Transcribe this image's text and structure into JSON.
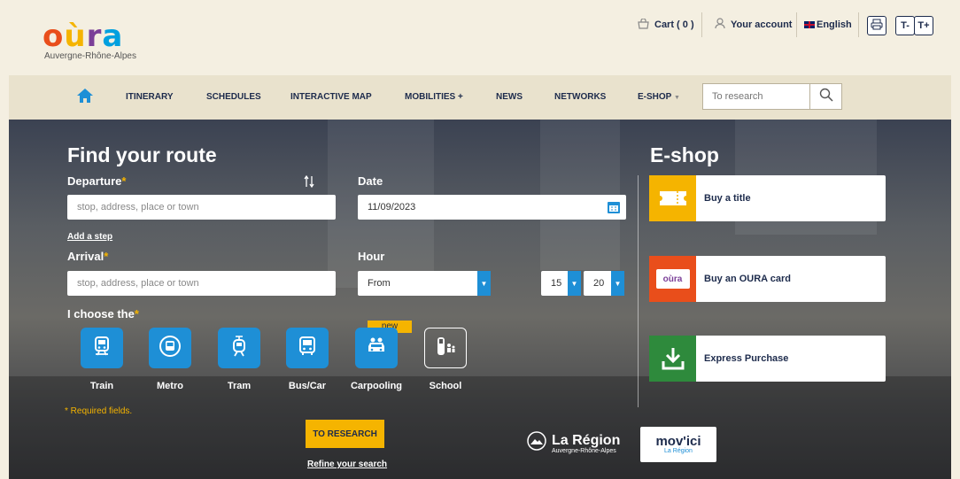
{
  "brand": {
    "logo_letters": [
      "o",
      "ù",
      "r",
      "a"
    ],
    "logo_colors": [
      "#e94e1b",
      "#f5b400",
      "#7b3f98",
      "#00a0df"
    ],
    "tagline": "Auvergne-Rhône-Alpes"
  },
  "topbar": {
    "cart": "Cart ( 0 )",
    "account": "Your account",
    "language": "English",
    "text_smaller": "T-",
    "text_larger": "T+"
  },
  "nav": {
    "items": [
      "ITINERARY",
      "SCHEDULES",
      "INTERACTIVE MAP",
      "MOBILITIES +",
      "NEWS",
      "NETWORKS",
      "E-SHOP"
    ],
    "search_placeholder": "To research"
  },
  "route": {
    "title": "Find your route",
    "departure_label": "Departure",
    "departure_placeholder": "stop, address, place or town",
    "add_step": "Add a step",
    "arrival_label": "Arrival",
    "arrival_placeholder": "stop, address, place or town",
    "date_label": "Date",
    "date_value": "11/09/2023",
    "hour_label": "Hour",
    "hour_mode": "From",
    "hour_h": "15",
    "hour_m": "20",
    "choose_label": "I choose the",
    "required_mark": "*",
    "modes": [
      "Train",
      "Metro",
      "Tram",
      "Bus/Car",
      "Carpooling",
      "School"
    ],
    "new_badge": "new",
    "required_note": "* Required fields.",
    "search_button": "TO RESEARCH",
    "refine_link": "Refine your search"
  },
  "eshop": {
    "title": "E-shop",
    "cards": [
      "Buy a title",
      "Buy an OURA card",
      "Express Purchase"
    ],
    "card_colors": [
      "#f5b400",
      "#e94e1b",
      "#2e8a3c"
    ],
    "oura_mini": "oùra"
  },
  "partners": {
    "region_name": "La Région",
    "region_sub": "Auvergne-Rhône-Alpes",
    "movici": "mov'ici",
    "movici_sub": "La Région"
  },
  "colors": {
    "accent": "#1e8fd6",
    "navy": "#1d2b4c",
    "yellow": "#f5b400"
  }
}
